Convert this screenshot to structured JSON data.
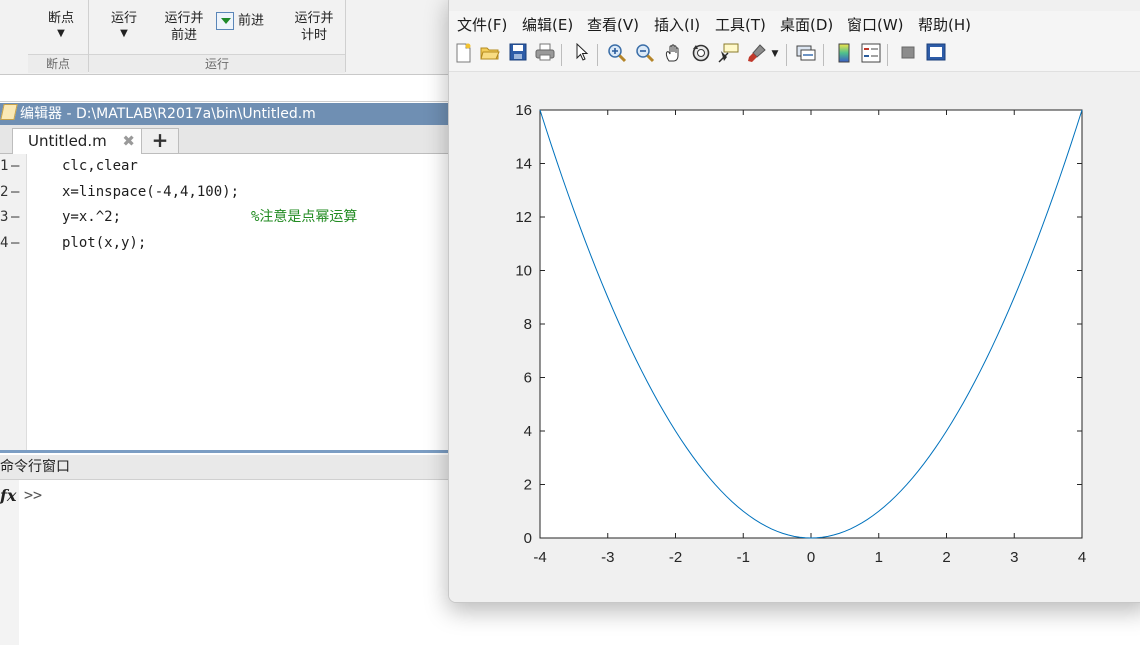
{
  "toolstrip": {
    "breakpoints_label": "断点",
    "run_label": "运行",
    "run_advance_label_1": "运行并",
    "run_advance_label_2": "前进",
    "advance_label": "前进",
    "run_time_label_1": "运行并",
    "run_time_label_2": "计时",
    "group_breakpoints": "断点",
    "group_run": "运行"
  },
  "editor": {
    "title": "编辑器 - D:\\MATLAB\\R2017a\\bin\\Untitled.m",
    "tab_label": "Untitled.m",
    "lines": [
      {
        "num": "1",
        "code": "clc,clear",
        "comment": ""
      },
      {
        "num": "2",
        "code": "x=linspace(-4,4,100);",
        "comment": ""
      },
      {
        "num": "3",
        "code": "y=x.^2;",
        "comment": "%注意是点幂运算"
      },
      {
        "num": "4",
        "code": "plot(x,y);",
        "comment": ""
      }
    ]
  },
  "command_window": {
    "title": "命令行窗口",
    "prompt": ">>"
  },
  "figure": {
    "menu": [
      "文件(F)",
      "编辑(E)",
      "查看(V)",
      "插入(I)",
      "工具(T)",
      "桌面(D)",
      "窗口(W)",
      "帮助(H)"
    ],
    "toolbar_icons": [
      "new-figure-icon",
      "open-file-icon",
      "save-icon",
      "print-icon",
      "edit-plot-icon",
      "zoom-in-icon",
      "zoom-out-icon",
      "pan-icon",
      "rotate-3d-icon",
      "data-cursor-icon",
      "brush-icon",
      "link-plot-icon",
      "colorbar-icon",
      "legend-icon",
      "hide-plot-tools-icon",
      "show-plot-tools-icon"
    ],
    "line_color": "#0072bd"
  },
  "chart_data": {
    "type": "line",
    "title": "",
    "xlabel": "",
    "ylabel": "",
    "xlim": [
      -4,
      4
    ],
    "ylim": [
      0,
      16
    ],
    "xticks": [
      "-4",
      "-3",
      "-2",
      "-1",
      "0",
      "1",
      "2",
      "3",
      "4"
    ],
    "yticks": [
      "0",
      "2",
      "4",
      "6",
      "8",
      "10",
      "12",
      "14",
      "16"
    ],
    "grid": false,
    "series": [
      {
        "x": [
          -4,
          -3.5,
          -3,
          -2.5,
          -2,
          -1.5,
          -1,
          -0.5,
          0,
          0.5,
          1,
          1.5,
          2,
          2.5,
          3,
          3.5,
          4
        ],
        "y": [
          16,
          12.25,
          9,
          6.25,
          4,
          2.25,
          1,
          0.25,
          0,
          0.25,
          1,
          2.25,
          4,
          6.25,
          9,
          12.25,
          16
        ]
      }
    ]
  }
}
